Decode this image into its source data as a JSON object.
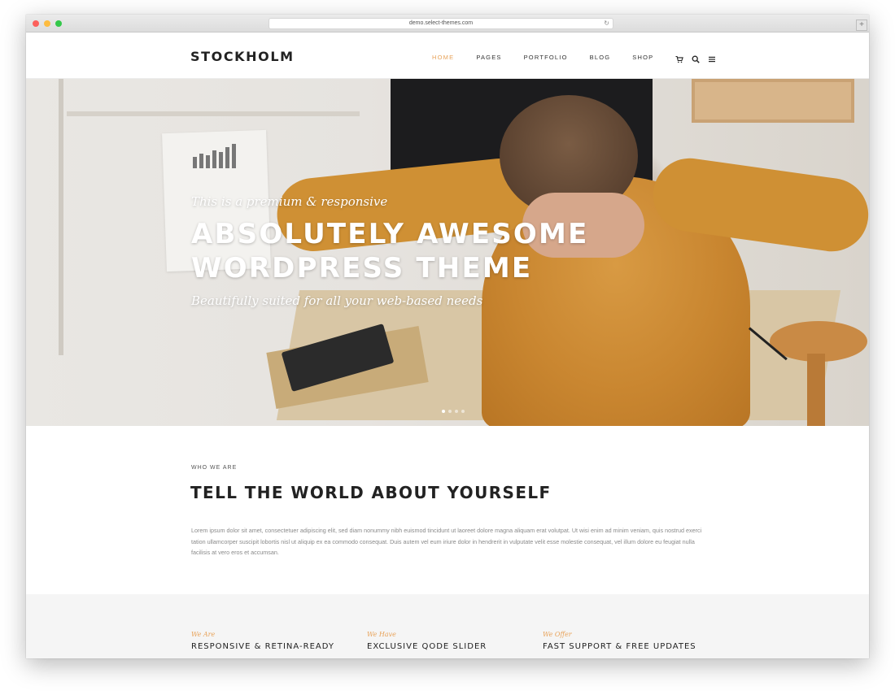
{
  "browser": {
    "url": "demo.select-themes.com"
  },
  "header": {
    "logo": "STOCKHOLM",
    "nav": [
      {
        "label": "HOME",
        "active": true
      },
      {
        "label": "PAGES"
      },
      {
        "label": "PORTFOLIO"
      },
      {
        "label": "BLOG"
      },
      {
        "label": "SHOP"
      }
    ],
    "icons": [
      "cart-icon",
      "search-icon",
      "menu-icon"
    ]
  },
  "hero": {
    "kicker": "This is a premium & responsive",
    "title_line1": "ABSOLUTELY AWESOME",
    "title_line2": "WORDPRESS THEME",
    "subtitle": "Beautifully suited for all your web-based needs",
    "slides": 4,
    "active_slide": 1
  },
  "about": {
    "kicker": "WHO WE ARE",
    "title": "TELL THE WORLD ABOUT YOURSELF",
    "body": "Lorem ipsum dolor sit amet, consectetuer adipiscing elit, sed diam nonummy nibh euismod tincidunt ut laoreet dolore magna aliquam erat volutpat. Ut wisi enim ad minim veniam, quis nostrud exerci tation ullamcorper suscipit lobortis nisl ut aliquip ex ea commodo consequat. Duis autem vel eum iriure dolor in hendrerit in vulputate velit esse molestie consequat, vel illum dolore eu feugiat nulla facilisis at vero eros et accumsan."
  },
  "features": [
    {
      "kicker": "We Are",
      "title": "RESPONSIVE & RETINA-READY"
    },
    {
      "kicker": "We Have",
      "title": "EXCLUSIVE QODE SLIDER"
    },
    {
      "kicker": "We Offer",
      "title": "FAST SUPPORT & FREE UPDATES"
    }
  ],
  "colors": {
    "accent": "#e8a35a"
  }
}
